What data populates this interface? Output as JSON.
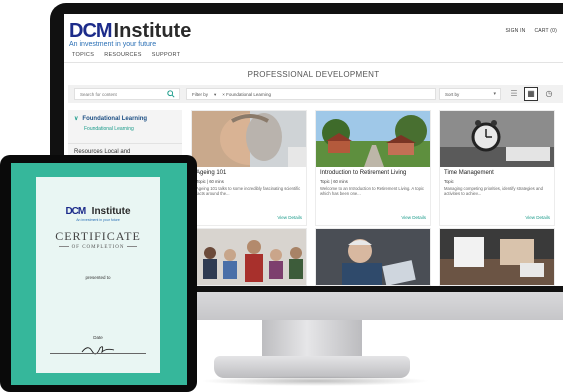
{
  "site": {
    "logo_dcm": "DCM",
    "logo_institute": "Institute",
    "tagline": "An investment in your future",
    "sign_in": "SIGN IN",
    "cart": "CART (0)"
  },
  "nav": {
    "items": [
      {
        "label": "TOPICS"
      },
      {
        "label": "RESOURCES"
      },
      {
        "label": "SUPPORT"
      }
    ]
  },
  "page": {
    "title": "PROFESSIONAL DEVELOPMENT"
  },
  "toolbar": {
    "search_placeholder": "Search for content",
    "filter_label": "Filter by",
    "filter_value": "× Foundational Learning",
    "sort_label": "Sort by"
  },
  "sidebar": {
    "section_title": "Foundational Learning",
    "section_item": "Foundational Learning",
    "next_section": "Resources Local and"
  },
  "cards": [
    {
      "title": "Ageing 101",
      "topic": "Topic | 60 mins",
      "desc": "Ageing 101 talks to some incredibly fascinating scientific facts around the...",
      "link": "View Details"
    },
    {
      "title": "Introduction to Retirement Living",
      "topic": "Topic | 60 mins",
      "desc": "Welcome to an Introduction to Retirement Living. A topic which has been one...",
      "link": "View Details"
    },
    {
      "title": "Time Management",
      "topic": "Topic",
      "desc": "Managing competing priorities, identify strategies and activities to achiev...",
      "link": "View Details"
    }
  ],
  "certificate": {
    "logo_dcm": "DCM",
    "logo_institute": "Institute",
    "tagline": "An investment in your future",
    "heading": "CERTIFICATE",
    "subheading": "OF COMPLETION",
    "presented": "presented to",
    "date": "Date"
  },
  "colors": {
    "brand_navy": "#1c2b8a",
    "brand_magenta": "#e0168a",
    "accent_teal": "#1a9b8a",
    "tablet_bg": "#36b79b"
  }
}
